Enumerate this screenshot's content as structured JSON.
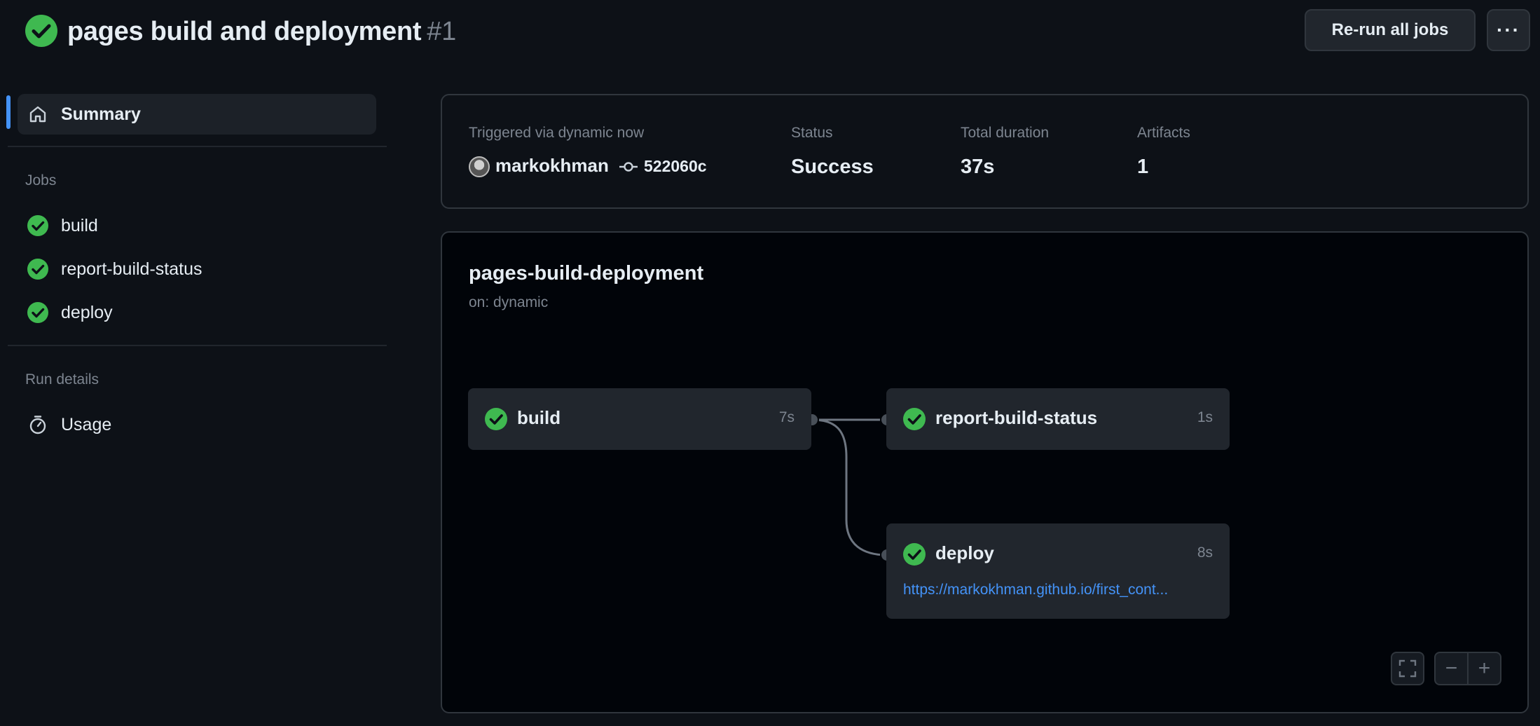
{
  "header": {
    "title": "pages build and deployment",
    "run_number": "#1",
    "rerun_label": "Re-run all jobs",
    "more_label": "···"
  },
  "sidebar": {
    "summary_label": "Summary",
    "jobs_heading": "Jobs",
    "jobs": [
      {
        "label": "build"
      },
      {
        "label": "report-build-status"
      },
      {
        "label": "deploy"
      }
    ],
    "run_details_heading": "Run details",
    "usage_label": "Usage"
  },
  "summary": {
    "trigger_label": "Triggered via dynamic now",
    "actor": "markokhman",
    "commit": "522060c",
    "status_label": "Status",
    "status_value": "Success",
    "duration_label": "Total duration",
    "duration_value": "37s",
    "artifacts_label": "Artifacts",
    "artifacts_value": "1"
  },
  "graph": {
    "workflow_name": "pages-build-deployment",
    "trigger": "on: dynamic",
    "jobs": {
      "build": {
        "name": "build",
        "duration": "7s"
      },
      "report": {
        "name": "report-build-status",
        "duration": "1s"
      },
      "deploy": {
        "name": "deploy",
        "duration": "8s",
        "url": "https://markokhman.github.io/first_cont..."
      }
    },
    "zoom_out": "−",
    "zoom_in": "+"
  },
  "colors": {
    "success": "#3fb950",
    "accent": "#4493f8",
    "background": "#0d1117"
  }
}
